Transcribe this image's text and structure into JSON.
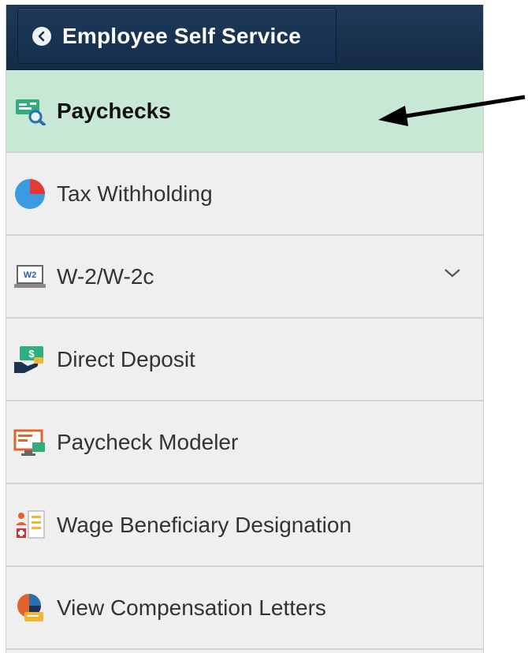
{
  "header": {
    "back_title": "Employee Self Service"
  },
  "nav": {
    "items": [
      {
        "label": "Paychecks",
        "icon": "paycheck-search-icon",
        "selected": true
      },
      {
        "label": "Tax Withholding",
        "icon": "pie-chart-icon"
      },
      {
        "label": "W-2/W-2c",
        "icon": "w2-laptop-icon",
        "expandable": true,
        "icon_text": "W2"
      },
      {
        "label": "Direct Deposit",
        "icon": "money-hand-icon"
      },
      {
        "label": "Paycheck Modeler",
        "icon": "monitor-chart-icon"
      },
      {
        "label": "Wage Beneficiary Designation",
        "icon": "beneficiary-list-icon"
      },
      {
        "label": "View Compensation Letters",
        "icon": "compensation-letters-icon"
      }
    ]
  },
  "colors": {
    "header_bg": "#1a3250",
    "selected_bg": "#c6e8d4",
    "menu_bg": "#efefef",
    "pie_blue": "#3a9be0",
    "pie_red": "#e53935"
  }
}
